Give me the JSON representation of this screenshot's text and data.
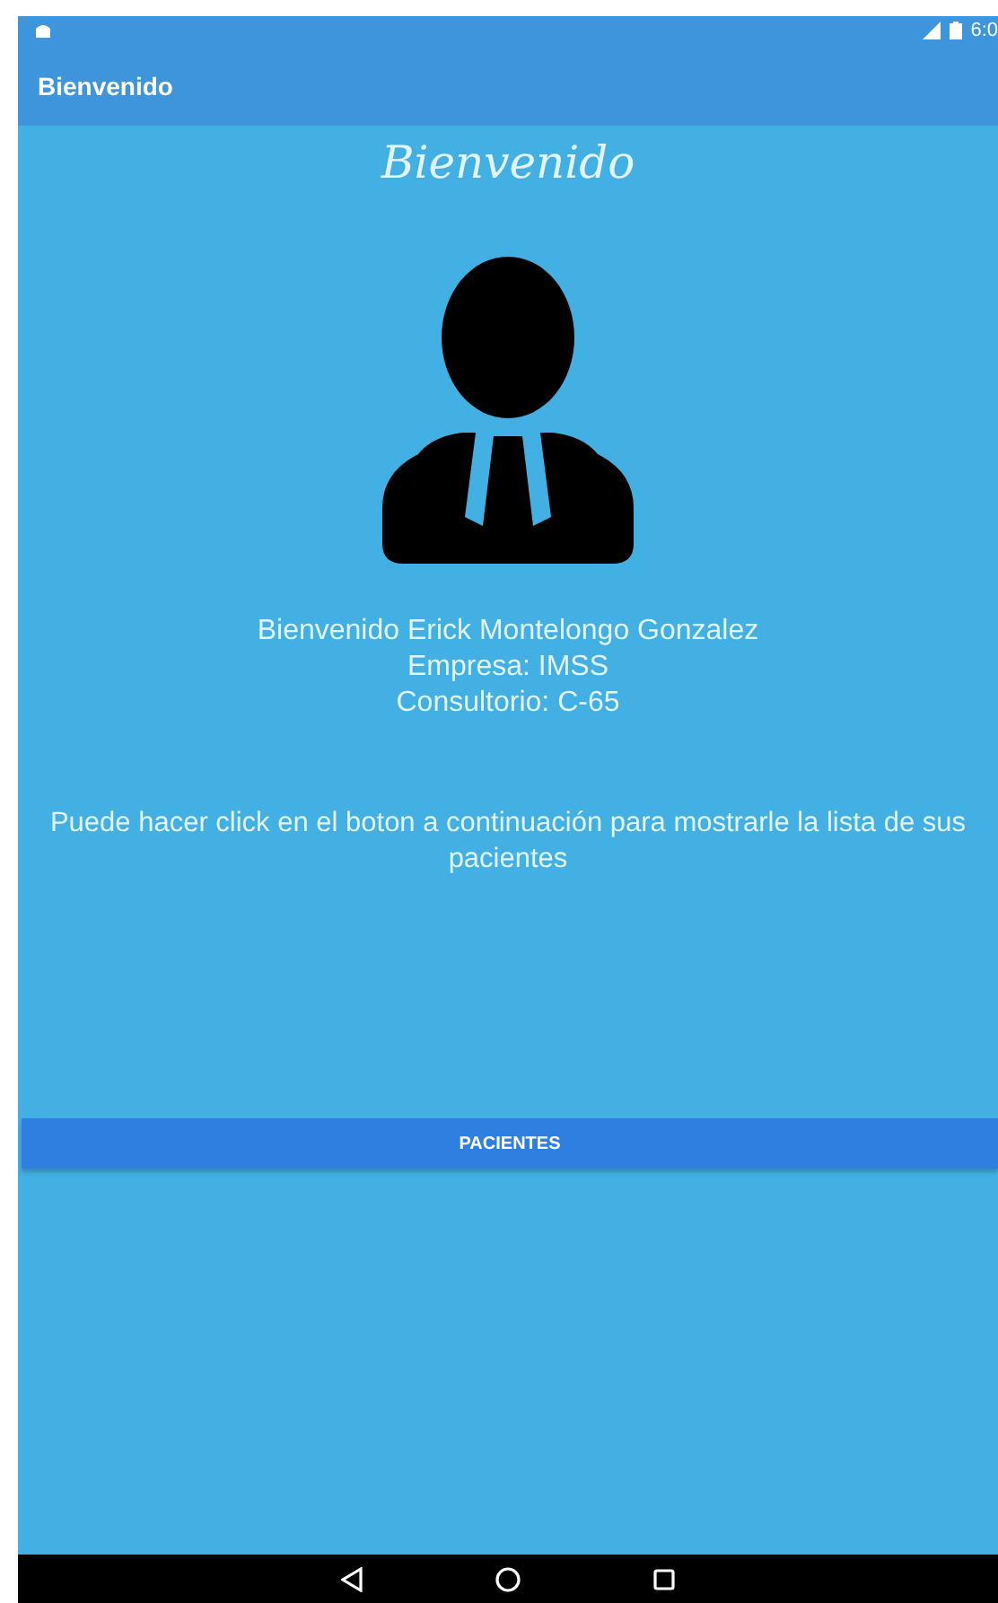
{
  "status_bar": {
    "time": "6:0"
  },
  "app_bar": {
    "title": "Bienvenido"
  },
  "heading": "Bienvenido",
  "info_lines": [
    "Bienvenido Erick Montelongo Gonzalez",
    "Empresa: IMSS",
    "Consultorio: C-65"
  ],
  "message": "Puede hacer click en el boton a continuación para mostrarle la lista de sus pacientes",
  "button": {
    "label": "PACIENTES"
  }
}
